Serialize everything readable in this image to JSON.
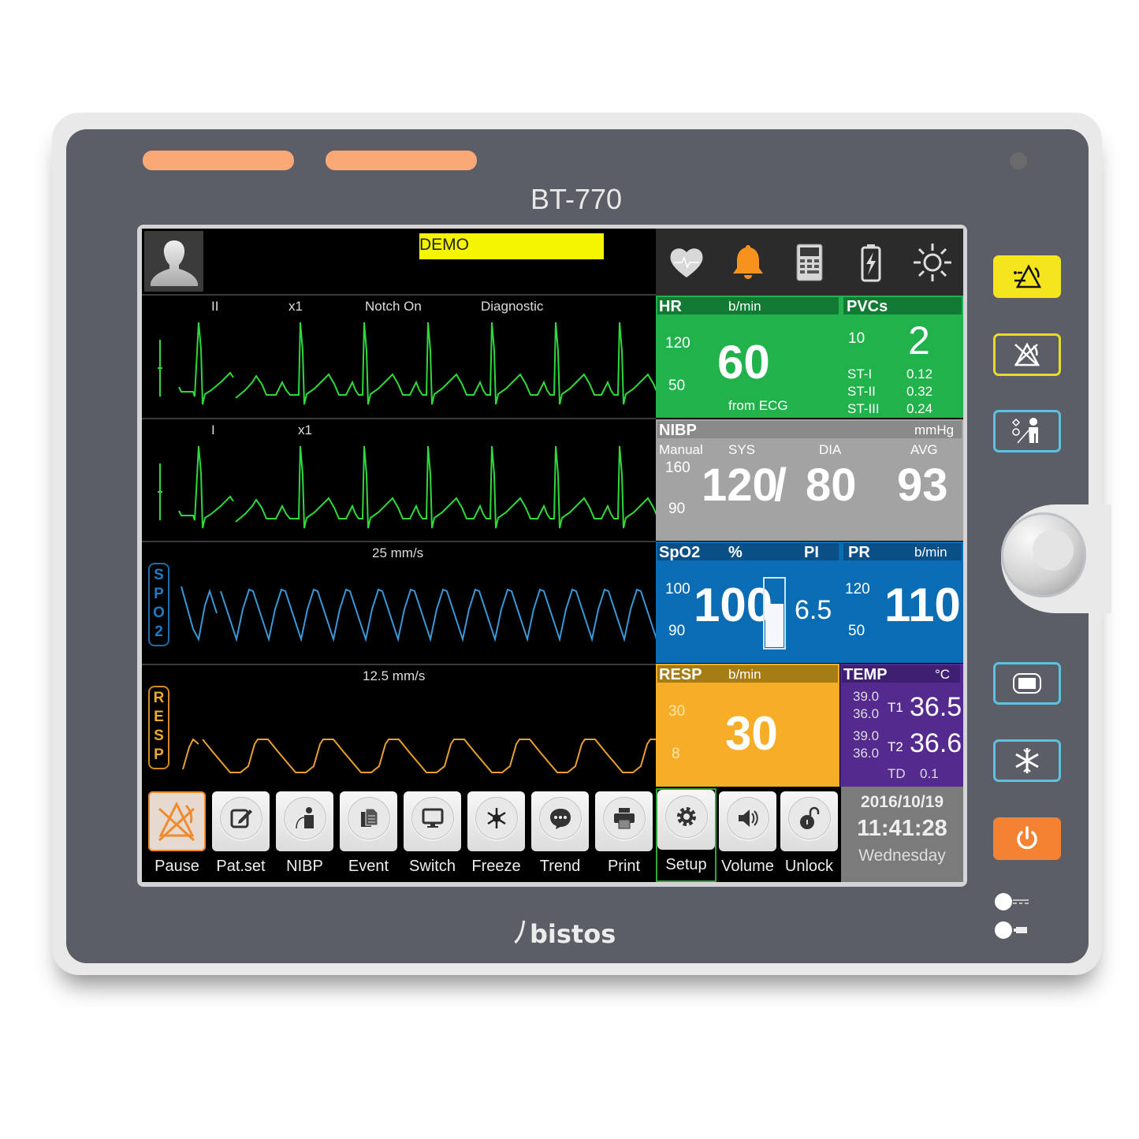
{
  "device": {
    "model": "BT-770",
    "brand": "bistos",
    "brand_mark": "ľ"
  },
  "header": {
    "patient_icon": "person-icon",
    "mode_badge": "DEMO",
    "status_icons": [
      "heart-icon",
      "alarm-bell-icon",
      "calculator-icon",
      "battery-charging-icon",
      "brightness-icon"
    ]
  },
  "waveforms": {
    "ecg1": {
      "lead": "II",
      "gain": "x1",
      "filter": "Notch On",
      "mode": "Diagnostic",
      "color": "#2fd93c"
    },
    "ecg2": {
      "lead": "I",
      "gain": "x1",
      "color": "#2fd93c"
    },
    "spo2": {
      "speed": "25 mm/s",
      "tag": [
        "S",
        "P",
        "O",
        "2"
      ],
      "color": "#3b97d6"
    },
    "resp": {
      "speed": "12.5 mm/s",
      "tag": [
        "R",
        "E",
        "S",
        "P"
      ],
      "color": "#e8a030"
    }
  },
  "params": {
    "hr": {
      "label": "HR",
      "unit": "b/min",
      "value": "60",
      "high": "120",
      "low": "50",
      "source": "from ECG",
      "color": "#21b24b"
    },
    "pvcs": {
      "label": "PVCs",
      "value": "2",
      "limit": "10",
      "st": [
        {
          "label": "ST-I",
          "value": "0.12"
        },
        {
          "label": "ST-II",
          "value": "0.32"
        },
        {
          "label": "ST-III",
          "value": "0.24"
        }
      ]
    },
    "nibp": {
      "label": "NIBP",
      "unit": "mmHg",
      "mode": "Manual",
      "sys_label": "SYS",
      "dia_label": "DIA",
      "avg_label": "AVG",
      "high": "160",
      "low": "90",
      "sys": "120",
      "separator": "/",
      "dia": "80",
      "avg": "93",
      "color": "#a3a3a3"
    },
    "spo2": {
      "label": "SpO2",
      "unit": "%",
      "pi_label": "PI",
      "value": "100",
      "high": "100",
      "low": "90",
      "pi": "6.5",
      "perfusion_fill": 0.62,
      "color": "#0a6db4"
    },
    "pr": {
      "label": "PR",
      "unit": "b/min",
      "value": "110",
      "high": "120",
      "low": "50"
    },
    "resp": {
      "label": "RESP",
      "unit": "b/min",
      "value": "30",
      "high": "30",
      "low": "8",
      "color": "#f6ad27"
    },
    "temp": {
      "label": "TEMP",
      "unit": "°C",
      "color": "#552a8e",
      "t1": {
        "label": "T1",
        "value": "36.5",
        "high": "39.0",
        "low": "36.0"
      },
      "t2": {
        "label": "T2",
        "value": "36.6",
        "high": "39.0",
        "low": "36.0"
      },
      "td": {
        "label": "TD",
        "value": "0.1"
      }
    }
  },
  "toolbar": [
    {
      "label": "Pause",
      "icon": "alarm-pause-icon"
    },
    {
      "label": "Pat.set",
      "icon": "edit-icon"
    },
    {
      "label": "NIBP",
      "icon": "nibp-patient-icon"
    },
    {
      "label": "Event",
      "icon": "documents-icon"
    },
    {
      "label": "Switch",
      "icon": "monitor-icon"
    },
    {
      "label": "Freeze",
      "icon": "snowflake-icon"
    },
    {
      "label": "Trend",
      "icon": "chat-bubble-icon"
    },
    {
      "label": "Print",
      "icon": "printer-icon"
    },
    {
      "label": "Setup",
      "icon": "gear-icon"
    },
    {
      "label": "Volume",
      "icon": "speaker-icon"
    },
    {
      "label": "Unlock",
      "icon": "unlock-icon"
    }
  ],
  "clock": {
    "date": "2016/10/19",
    "time": "11:41:28",
    "day": "Wednesday"
  },
  "side_buttons": [
    {
      "name": "alarm-reset-button",
      "icon": "alarm-reset-icon"
    },
    {
      "name": "alarm-silence-button",
      "icon": "alarm-silence-icon"
    },
    {
      "name": "nibp-start-button",
      "icon": "nibp-start-icon"
    },
    {
      "name": "main-screen-button",
      "icon": "screen-icon"
    },
    {
      "name": "freeze-hard-button",
      "icon": "snowflake-icon"
    },
    {
      "name": "power-button",
      "icon": "power-icon"
    }
  ]
}
